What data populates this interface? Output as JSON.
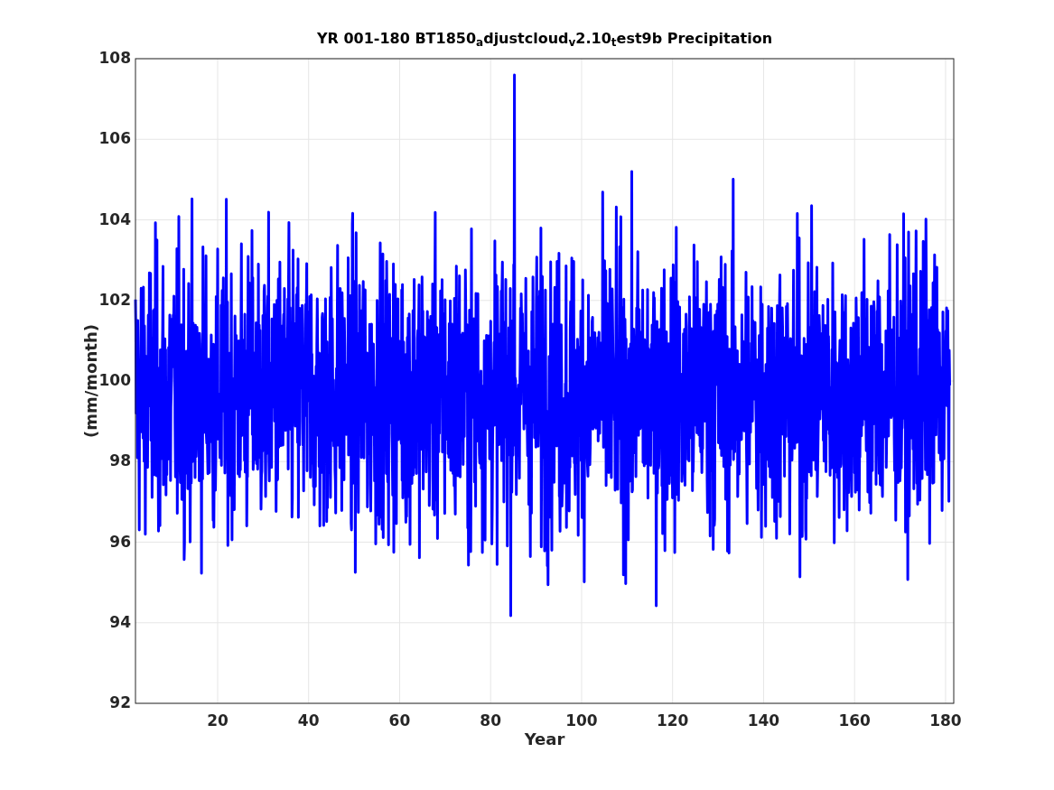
{
  "figure": {
    "title": "YR 001-180 BT1850$_{a}$djustcloud$_{v}$2.10$_{t}$est9b Precipitation",
    "xlabel": "Year",
    "ylabel": "(mm/month)",
    "xticks": [
      "20",
      "40",
      "60",
      "80",
      "100",
      "120",
      "140",
      "160",
      "180"
    ],
    "yticks": [
      "108",
      "106",
      "104",
      "102",
      "100",
      "98",
      "96",
      "94",
      "92"
    ]
  }
}
